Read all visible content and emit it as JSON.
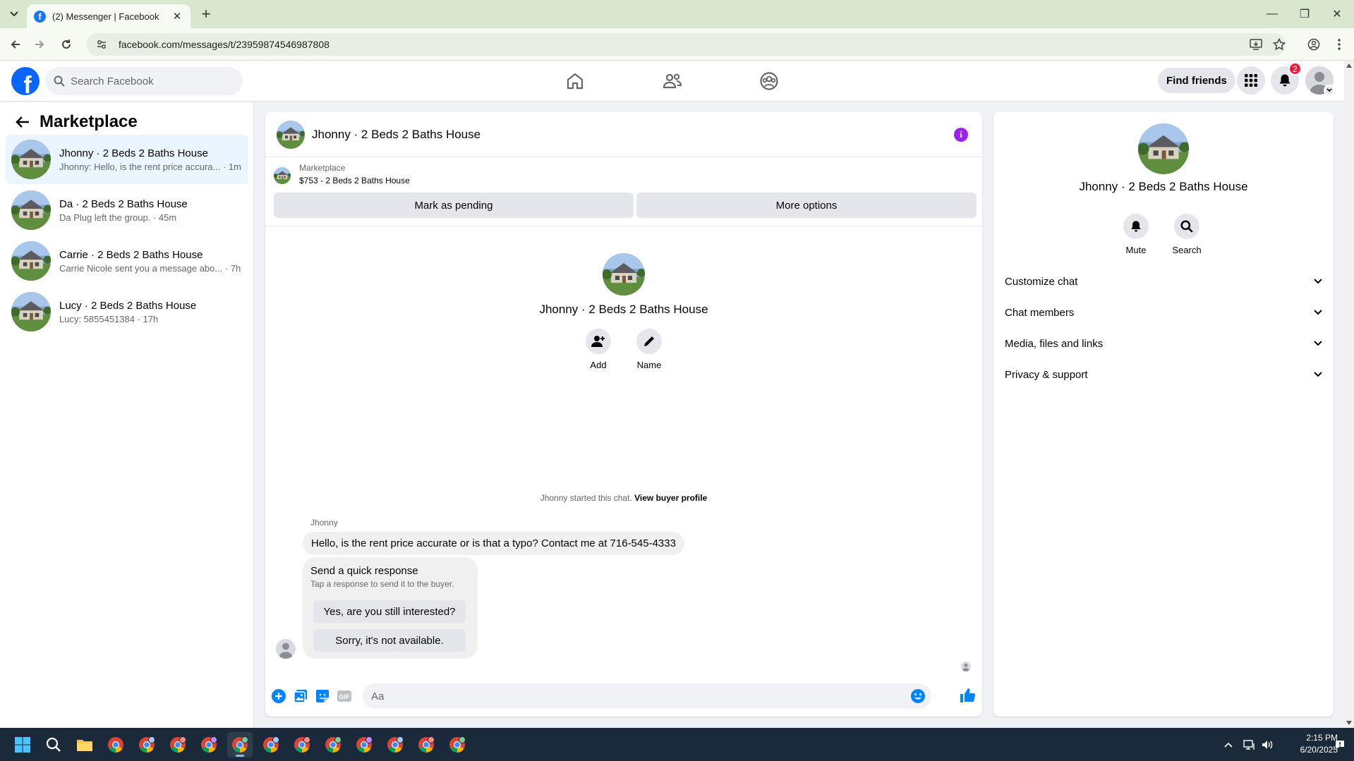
{
  "browser": {
    "tab_title": "(2) Messenger | Facebook",
    "url": "facebook.com/messages/t/23959874546987808"
  },
  "fb_nav": {
    "search_placeholder": "Search Facebook",
    "find_friends_label": "Find friends",
    "notification_count": "2"
  },
  "sidebar": {
    "title": "Marketplace",
    "conversations": [
      {
        "name": "Jhonny · 2 Beds 2 Baths House",
        "preview": "Jhonny: Hello, is the rent price accura... · 1m",
        "active": true
      },
      {
        "name": "Da · 2 Beds 2 Baths House",
        "preview": "Da Plug left the group. · 45m",
        "active": false
      },
      {
        "name": "Carrie · 2 Beds 2 Baths House",
        "preview": "Carrie Nicole sent you a message abo... · 7h",
        "active": false
      },
      {
        "name": "Lucy · 2 Beds 2 Baths House",
        "preview": "Lucy: 5855451384 · 17h",
        "active": false
      }
    ]
  },
  "chat": {
    "header_name": "Jhonny · 2 Beds 2 Baths House",
    "listing": {
      "source": "Marketplace",
      "price_title": "$753 - 2 Beds 2 Baths House",
      "mark_pending_label": "Mark as pending",
      "more_options_label": "More options"
    },
    "intro": {
      "name": "Jhonny · 2 Beds 2 Baths House",
      "add_label": "Add",
      "name_label": "Name"
    },
    "started_text": "Jhonny started this chat.",
    "view_buyer_profile": "View buyer profile",
    "sender": "Jhonny",
    "message": "Hello, is the rent price accurate or is that a typo? Contact me at 716-545-4333",
    "quick_response": {
      "title": "Send a quick response",
      "subtitle": "Tap a response to send it to the buyer.",
      "options": [
        "Yes, are you still interested?",
        "Sorry, it's not available."
      ]
    },
    "composer_placeholder": "Aa"
  },
  "right_panel": {
    "name": "Jhonny · 2 Beds 2 Baths House",
    "mute_label": "Mute",
    "search_label": "Search",
    "sections": [
      "Customize chat",
      "Chat members",
      "Media, files and links",
      "Privacy & support"
    ]
  },
  "taskbar": {
    "time": "2:15 PM",
    "date": "6/20/2025"
  },
  "colors": {
    "fb_blue": "#0866ff",
    "messenger_blue": "#0084ff",
    "info_purple": "#a020f0",
    "badge_red": "#e41e3f",
    "active_conversation": "#ebf5ff"
  }
}
